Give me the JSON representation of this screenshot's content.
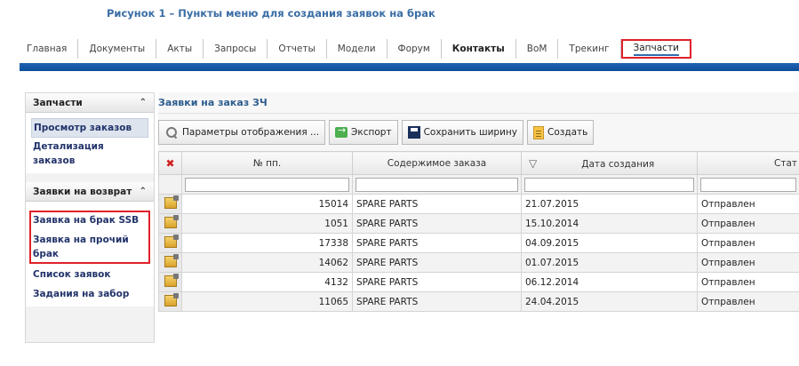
{
  "caption": "Рисунок 1 – Пункты меню для создания заявок на брак",
  "topnav": [
    {
      "label": "Главная"
    },
    {
      "label": "Документы"
    },
    {
      "label": "Акты"
    },
    {
      "label": "Запросы"
    },
    {
      "label": "Отчеты"
    },
    {
      "label": "Модели"
    },
    {
      "label": "Форум"
    },
    {
      "label": "Контакты"
    },
    {
      "label": "BoM"
    },
    {
      "label": "Трекинг"
    },
    {
      "label": "Запчасти"
    }
  ],
  "sidebar": {
    "section1": {
      "title": "Запчасти",
      "items": [
        "Просмотр заказов",
        "Детализация заказов"
      ]
    },
    "section2": {
      "title": "Заявки на возврат",
      "items": [
        "Заявка на брак SSB",
        "Заявка на прочий брак",
        "Список заявок",
        "Задания на забор"
      ]
    }
  },
  "main": {
    "title": "Заявки на заказ ЗЧ",
    "toolbar": {
      "params": "Параметры отображения ...",
      "export": "Экспорт",
      "save_width": "Сохранить ширину",
      "create": "Создать"
    },
    "columns": [
      "№ пп.",
      "Содержимое заказа",
      "Дата создания",
      "Стат"
    ],
    "rows": [
      {
        "num": "15014",
        "content": "SPARE PARTS",
        "date": "21.07.2015",
        "status": "Отправлен"
      },
      {
        "num": "1051",
        "content": "SPARE PARTS",
        "date": "15.10.2014",
        "status": "Отправлен"
      },
      {
        "num": "17338",
        "content": "SPARE PARTS",
        "date": "04.09.2015",
        "status": "Отправлен"
      },
      {
        "num": "14062",
        "content": "SPARE PARTS",
        "date": "01.07.2015",
        "status": "Отправлен"
      },
      {
        "num": "4132",
        "content": "SPARE PARTS",
        "date": "06.12.2014",
        "status": "Отправлен"
      },
      {
        "num": "11065",
        "content": "SPARE PARTS",
        "date": "24.04.2015",
        "status": "Отправлен"
      }
    ]
  }
}
